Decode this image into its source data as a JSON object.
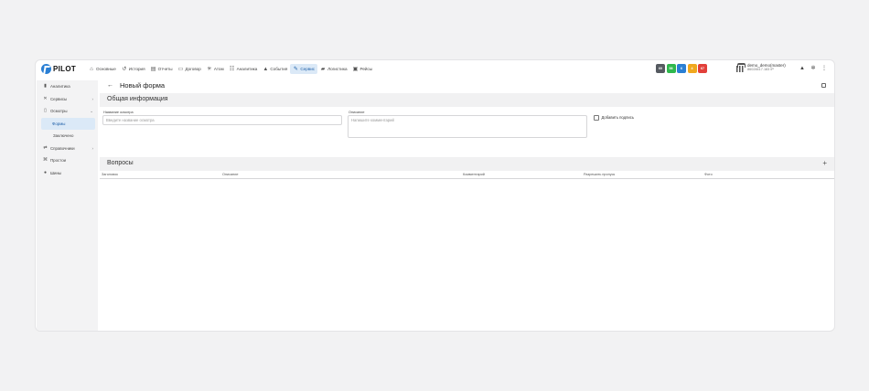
{
  "app": {
    "logo": "PILOT",
    "nav": [
      {
        "label": "Основные",
        "icon": "home-icon"
      },
      {
        "label": "История",
        "icon": "history-icon"
      },
      {
        "label": "Отчеты",
        "icon": "report-icon"
      },
      {
        "label": "Договор",
        "icon": "contract-icon"
      },
      {
        "label": "Атом",
        "icon": "atom-icon"
      },
      {
        "label": "Аналитика",
        "icon": "analytics-icon"
      },
      {
        "label": "События",
        "icon": "bell-icon"
      },
      {
        "label": "Сервис",
        "icon": "wrench-icon"
      },
      {
        "label": "Логистика",
        "icon": "truck-icon"
      },
      {
        "label": "Рейсы",
        "icon": "bus-icon"
      }
    ],
    "badges": [
      {
        "value": "60",
        "color": "#555a60"
      },
      {
        "value": "58",
        "color": "#2fb84d"
      },
      {
        "value": "6",
        "color": "#2a7fd4"
      },
      {
        "value": "4",
        "color": "#f0a81e"
      },
      {
        "value": "67",
        "color": "#e2403a"
      }
    ],
    "user": {
      "name": "demo_demo(master)",
      "sub": "86028417.183 IP"
    }
  },
  "sidebar": {
    "items": [
      {
        "label": "Аналитика",
        "icon": "chart-icon"
      },
      {
        "label": "Сервисы",
        "icon": "tools-icon"
      },
      {
        "label": "Осмотры",
        "icon": "document-icon"
      },
      {
        "label": "Формы"
      },
      {
        "label": "Заключено"
      },
      {
        "label": "Справочники",
        "icon": "directory-icon"
      },
      {
        "label": "Простои",
        "icon": "downtime-icon"
      },
      {
        "label": "Шины",
        "icon": "tire-icon"
      }
    ]
  },
  "page": {
    "title": "Новый форма",
    "general_section": "Общая информация",
    "name_label": "Название осмотра",
    "name_placeholder": "Введите название осмотра",
    "desc_label": "Описание",
    "desc_placeholder": "Напишите комментарий",
    "signature_label": "Добавить подпись",
    "questions_section": "Вопросы",
    "columns": [
      "Заголовок",
      "Описание",
      "Комментарий",
      "Разрешить пропуск",
      "Фото"
    ]
  }
}
